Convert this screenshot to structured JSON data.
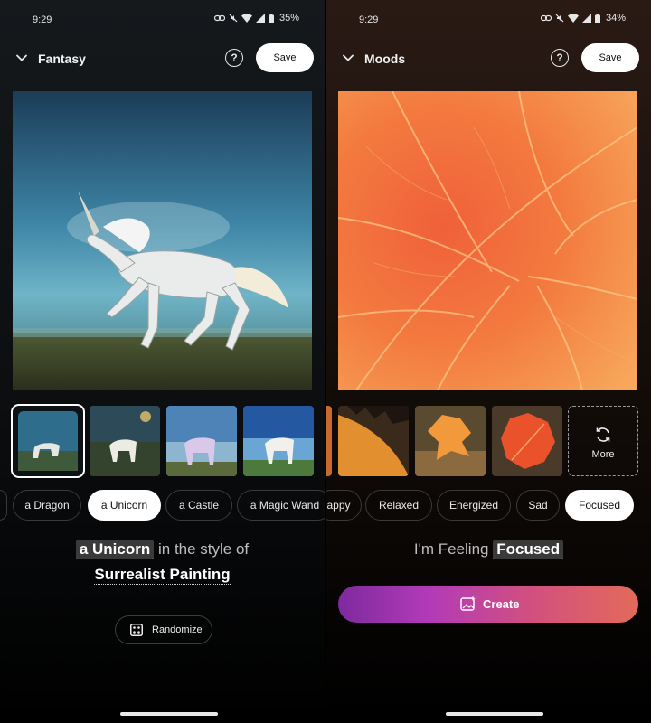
{
  "left": {
    "status": {
      "time": "9:29",
      "battery": "35%"
    },
    "header": {
      "title": "Fantasy",
      "help": "?",
      "save_label": "Save"
    },
    "chips": [
      "a Dragon",
      "a Unicorn",
      "a Castle",
      "a Magic Wand"
    ],
    "active_chip": "a Unicorn",
    "prompt": {
      "subject": "a Unicorn",
      "connector": "in the style of",
      "style": "Surrealist Painting"
    },
    "randomize_label": "Randomize"
  },
  "right": {
    "status": {
      "time": "9:29",
      "battery": "34%"
    },
    "header": {
      "title": "Moods",
      "help": "?",
      "save_label": "Save"
    },
    "chips": [
      "appy",
      "Relaxed",
      "Energized",
      "Sad",
      "Focused"
    ],
    "active_chip": "Focused",
    "more_label": "More",
    "prompt": {
      "prefix": "I'm Feeling",
      "mood": "Focused"
    },
    "create_label": "Create"
  },
  "colors": {
    "accent_start": "#7e2a9e",
    "accent_end": "#e36a5a"
  }
}
